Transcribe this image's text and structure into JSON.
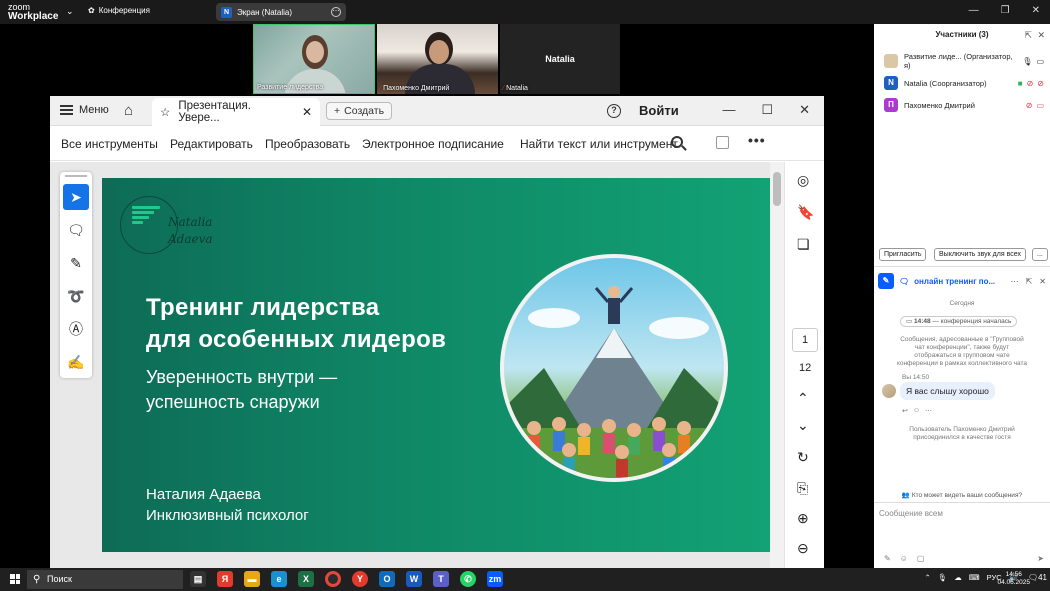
{
  "zoom_bar": {
    "logo_top": "zoom",
    "logo_bottom": "Workplace",
    "conference_label": "Конференция",
    "screen_label": "Экран (Natalia)",
    "screen_initial": "N"
  },
  "videos": [
    {
      "label": "Развитие лидерства"
    },
    {
      "label": "Пахоменко Дмитрий"
    },
    {
      "label": "Natalia",
      "name": "Natalia"
    }
  ],
  "acrobat": {
    "menu_label": "Меню",
    "tab_label": "Презентация. Увере...",
    "create_label": "Создать",
    "login_label": "Войти",
    "toolbar": {
      "all_tools": "Все инструменты",
      "edit": "Редактировать",
      "convert": "Преобразовать",
      "esign": "Электронное подписание",
      "find": "Найти текст или инструмент"
    },
    "page_current": "1",
    "page_total": "12"
  },
  "slide": {
    "logo_line1": "Natalia",
    "logo_line2": "Adaeva",
    "title_line1": "Тренинг лидерства",
    "title_line2": "для особенных лидеров",
    "subtitle_line1": "Уверенность внутри —",
    "subtitle_line2": "успешность снаружи",
    "author_name": "Наталия Адаева",
    "author_role": "Инклюзивный психолог"
  },
  "participants_panel": {
    "title": "Участники (3)",
    "participants": [
      {
        "name": "Развитие лиде... (Организатор, я)",
        "initial": "",
        "color": "#d9c7a6"
      },
      {
        "name": "Natalia (Соорганизатор)",
        "initial": "N",
        "color": "#1f5fbf"
      },
      {
        "name": "Пахоменко Дмитрий",
        "initial": "П",
        "color": "#a93ccf"
      }
    ],
    "invite_label": "Пригласить",
    "mute_all_label": "Выключить звук для всех",
    "more_label": "..."
  },
  "chat": {
    "title": "онлайн тренинг по...",
    "date_label": "Сегодня",
    "system_time": "14:48",
    "system_text": "— конференция началась",
    "notice": "Сообщения, адресованные в \"Групповой чат конференции\", также будут отображаться в групповом чате конференции в рамках коллективного чата",
    "msg_meta": "Вы 14:50",
    "msg_text": "Я вас слышу хорошо",
    "joined_text": "Пользователь Пахоменко Дмитрий присоединился в качестве гостя",
    "who_sees": "Кто может видеть ваши сообщения?",
    "compose_placeholder": "Сообщение всем"
  },
  "taskbar": {
    "search_label": "Поиск",
    "lang": "РУС",
    "time": "14:56",
    "date": "04.06.2025",
    "notif_count": "41"
  },
  "colors": {
    "zoom_blue": "#0b5cff",
    "acrobat_select": "#1473e6",
    "slide_green": "#0f8866",
    "mute_red": "#e0323c"
  }
}
